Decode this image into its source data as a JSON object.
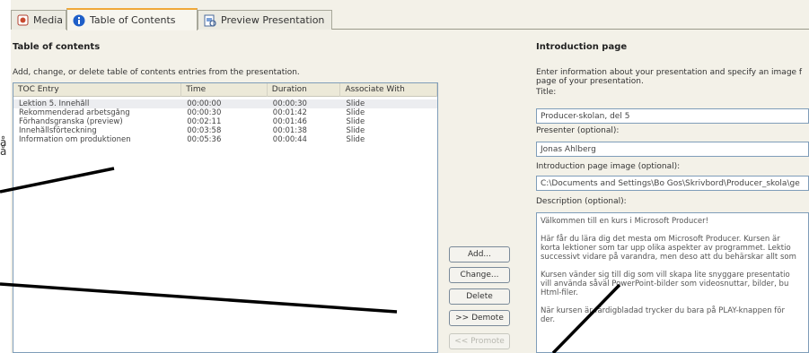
{
  "left_fragment": [
    "å",
    "å"
  ],
  "tabs": [
    {
      "label": "Media",
      "icon": "media-icon"
    },
    {
      "label": "Table of Contents",
      "icon": "info-icon"
    },
    {
      "label": "Preview Presentation",
      "icon": "preview-icon"
    }
  ],
  "toc": {
    "heading": "Table of contents",
    "description": "Add, change, or delete table of contents entries from the presentation.",
    "columns": [
      "TOC Entry",
      "Time",
      "Duration",
      "Associate With"
    ],
    "rows": [
      [
        "Lektion 5. Innehåll",
        "00:00:00",
        "00:00:30",
        "Slide"
      ],
      [
        "Rekommenderad arbetsgång",
        "00:00:30",
        "00:01:42",
        "Slide"
      ],
      [
        "Förhandsgranska (preview)",
        "00:02:11",
        "00:01:46",
        "Slide"
      ],
      [
        "Innehållsförteckning",
        "00:03:58",
        "00:01:38",
        "Slide"
      ],
      [
        "Information om produktionen",
        "00:05:36",
        "00:00:44",
        "Slide"
      ]
    ]
  },
  "buttons": {
    "add": "Add...",
    "change": "Change...",
    "delete": "Delete",
    "demote": ">> Demote",
    "promote": "<< Promote"
  },
  "intro": {
    "heading": "Introduction page",
    "description_line1": "Enter information about your presentation and specify an image f",
    "description_line2": "page of your presentation.",
    "title_label": "Title:",
    "title_value": "Producer-skolan, del 5",
    "presenter_label": "Presenter (optional):",
    "presenter_value": "Jonas Ahlberg",
    "image_label": "Introduction page image (optional):",
    "image_value": "C:\\Documents and Settings\\Bo Gos\\Skrivbord\\Producer_skola\\ge",
    "desc_label": "Description (optional):",
    "desc_lines": [
      "Välkommen till en kurs i Microsoft Producer!",
      "Här får du lära dig det mesta om Microsoft Producer. Kursen är",
      "korta lektioner som tar upp olika aspekter av programmet. Lektio",
      "successivt vidare på varandra, men deso att du behärskar allt som",
      "Kursen vänder sig till dig som vill skapa lite snyggare presentatio",
      "vill använda såväl PowerPoint-bilder som videosnuttar, bilder, bu",
      "Html-filer.",
      "När kursen är färdigbladad trycker du bara på PLAY-knappen för",
      "der."
    ]
  }
}
